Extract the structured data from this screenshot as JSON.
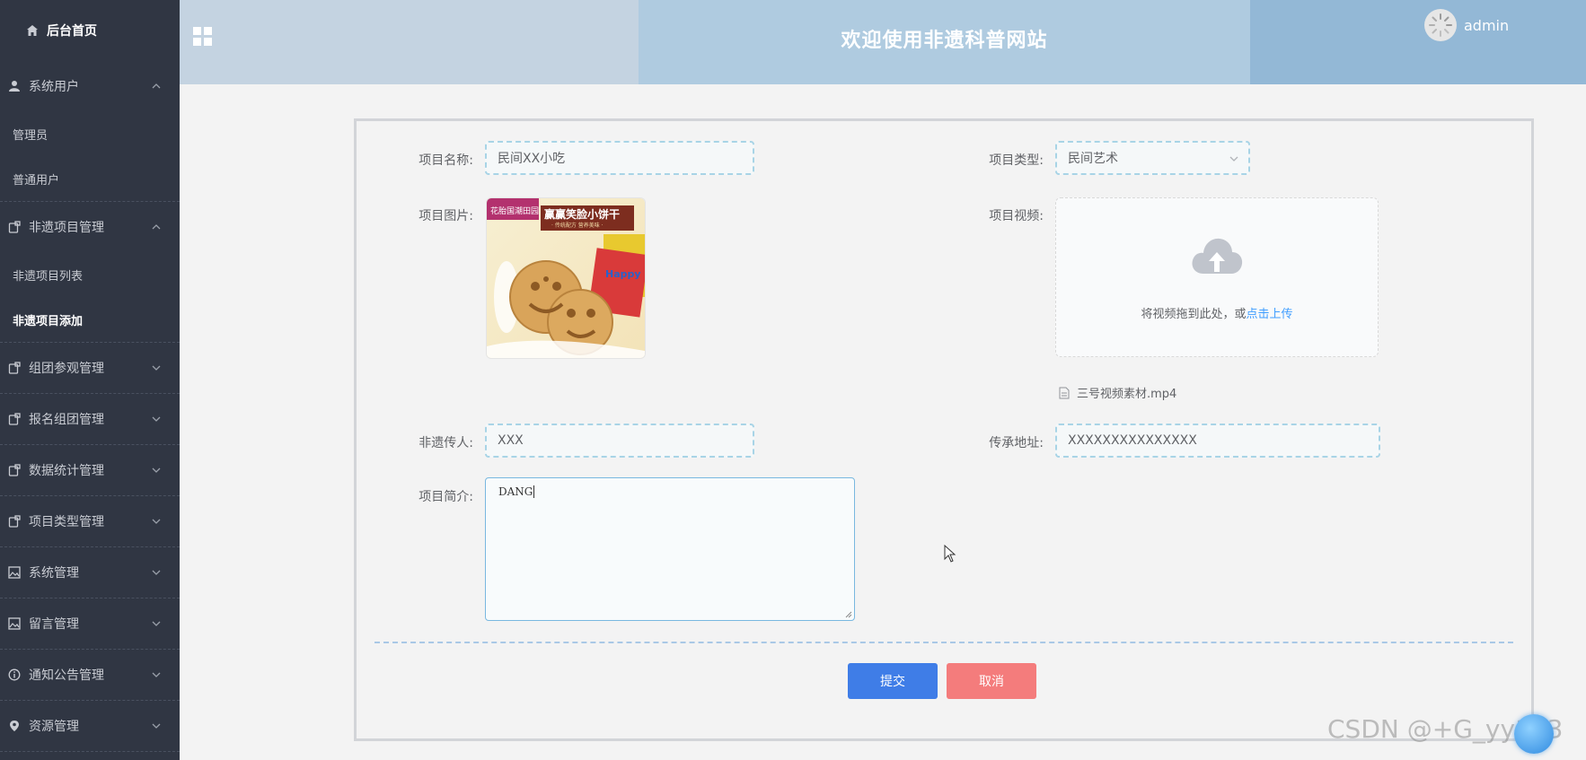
{
  "colors": {
    "sidebar_bg": "#303643",
    "submit": "#3f7de7",
    "cancel": "#f47c7c",
    "link": "#409eff",
    "input_border": "#a8d4e6"
  },
  "sidebar": {
    "home": "后台首页",
    "groups": [
      {
        "label": "系统用户",
        "icon": "user-icon",
        "expanded": true,
        "items": [
          {
            "label": "管理员"
          },
          {
            "label": "普通用户"
          }
        ]
      },
      {
        "label": "非遗项目管理",
        "icon": "folder-icon",
        "expanded": true,
        "items": [
          {
            "label": "非遗项目列表"
          },
          {
            "label": "非遗项目添加",
            "active": true
          }
        ]
      },
      {
        "label": "组团参观管理",
        "icon": "folder-icon",
        "expanded": false
      },
      {
        "label": "报名组团管理",
        "icon": "folder-icon",
        "expanded": false
      },
      {
        "label": "数据统计管理",
        "icon": "folder-icon",
        "expanded": false
      },
      {
        "label": "项目类型管理",
        "icon": "folder-icon",
        "expanded": false
      },
      {
        "label": "系统管理",
        "icon": "image-icon",
        "expanded": false
      },
      {
        "label": "留言管理",
        "icon": "image-icon",
        "expanded": false
      },
      {
        "label": "通知公告管理",
        "icon": "info-icon",
        "expanded": false
      },
      {
        "label": "资源管理",
        "icon": "location-icon",
        "expanded": false
      }
    ]
  },
  "header": {
    "title": "欢迎使用非遗科普网站",
    "username": "admin"
  },
  "form": {
    "name_label": "项目名称:",
    "name_value": "民间XX小吃",
    "type_label": "项目类型:",
    "type_value": "民间艺术",
    "image_label": "项目图片:",
    "image_text": {
      "badge": "花胎国潮田园",
      "title": "赢赢笑脸小饼干",
      "subtitle": "· 传统配方 营养美味 ·",
      "box": "Happy Moo"
    },
    "video_label": "项目视频:",
    "upload_hint": "将视频拖到此处，或",
    "upload_link": "点击上传",
    "uploaded_file": "三号视频素材.mp4",
    "inheritor_label": "非遗传人:",
    "inheritor_value": "XXX",
    "address_label": "传承地址:",
    "address_value": "XXXXXXXXXXXXXXX",
    "intro_label": "项目简介:",
    "intro_value": "DANG"
  },
  "buttons": {
    "submit": "提交",
    "cancel": "取消"
  },
  "watermark": "CSDN @+G_yy163"
}
